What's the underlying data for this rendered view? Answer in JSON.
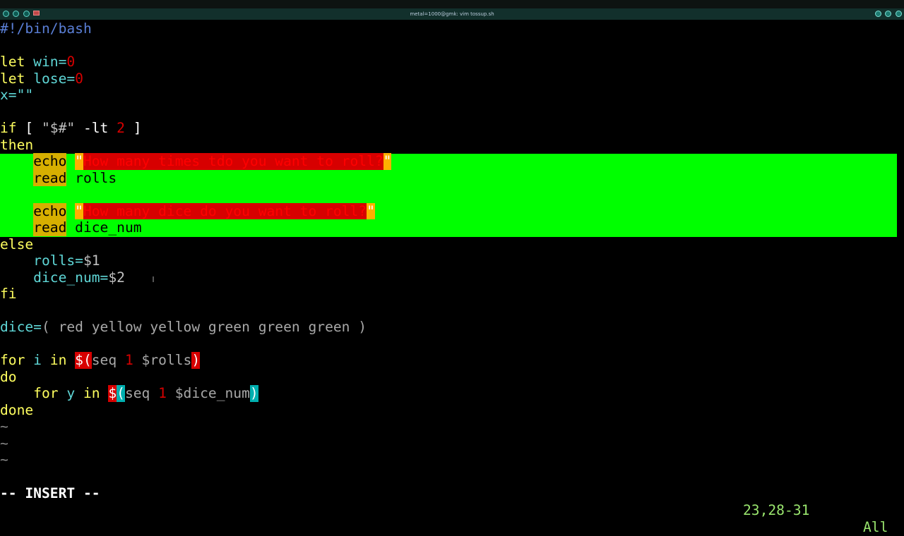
{
  "window": {
    "title": "metal=1000@gmk: vim tossup.sh"
  },
  "editor": {
    "lines": [
      {
        "segments": [
          {
            "t": "#!/bin/bash",
            "c": "#5a7fd6"
          }
        ]
      },
      {
        "segments": []
      },
      {
        "segments": [
          {
            "t": "let",
            "c": "#ffff5f"
          },
          {
            "t": " win=",
            "c": "#5fd7d7"
          },
          {
            "t": "0",
            "c": "#d70000"
          }
        ]
      },
      {
        "segments": [
          {
            "t": "let",
            "c": "#ffff5f"
          },
          {
            "t": " lose=",
            "c": "#5fd7d7"
          },
          {
            "t": "0",
            "c": "#d70000"
          }
        ]
      },
      {
        "segments": [
          {
            "t": "x=\"\"",
            "c": "#5fd7d7"
          }
        ]
      },
      {
        "segments": []
      },
      {
        "segments": [
          {
            "t": "if",
            "c": "#ffff5f"
          },
          {
            "t": " [ ",
            "c": "#ffffff"
          },
          {
            "t": "\"$#\"",
            "c": "#c0c0c0"
          },
          {
            "t": " -lt ",
            "c": "#ffffff"
          },
          {
            "t": "2",
            "c": "#d70000"
          },
          {
            "t": " ]",
            "c": "#ffffff"
          }
        ]
      },
      {
        "segments": [
          {
            "t": "then",
            "c": "#ffff5f"
          }
        ]
      },
      {
        "segments": [
          {
            "t": "    ",
            "c": "#000"
          },
          {
            "t": "echo",
            "c": "#000000",
            "bg": "#d7af00"
          },
          {
            "t": " ",
            "c": "#000"
          },
          {
            "t": "\"",
            "c": "#ffffff",
            "bg": "#ffaf00"
          },
          {
            "t": "How many times tdo you want to roll?",
            "c": "#ff0000",
            "bg": "#d70000"
          },
          {
            "t": "\"",
            "c": "#ffffff",
            "bg": "#ffaf00"
          }
        ]
      },
      {
        "segments": [
          {
            "t": "    ",
            "c": "#000"
          },
          {
            "t": "read",
            "c": "#000000",
            "bg": "#d7af00"
          },
          {
            "t": " rolls",
            "c": "#000000"
          }
        ]
      },
      {
        "segments": []
      },
      {
        "segments": [
          {
            "t": "    ",
            "c": "#000"
          },
          {
            "t": "echo",
            "c": "#000000",
            "bg": "#d7af00"
          },
          {
            "t": " ",
            "c": "#000"
          },
          {
            "t": "\"",
            "c": "#ffffff",
            "bg": "#ffaf00"
          },
          {
            "t": "How many dice do you want to roll?",
            "c": "#ff0000",
            "bg": "#d70000"
          },
          {
            "t": "\"",
            "c": "#ffffff",
            "bg": "#ffaf00"
          }
        ]
      },
      {
        "segments": [
          {
            "t": "    ",
            "c": "#000"
          },
          {
            "t": "read",
            "c": "#000000",
            "bg": "#d7af00"
          },
          {
            "t": " dice_num",
            "c": "#000000"
          }
        ]
      },
      {
        "segments": [
          {
            "t": "else",
            "c": "#ffff5f"
          }
        ]
      },
      {
        "segments": [
          {
            "t": "    rolls=",
            "c": "#5fd7d7"
          },
          {
            "t": "$1",
            "c": "#c0c0c0"
          }
        ]
      },
      {
        "segments": [
          {
            "t": "    dice_num=",
            "c": "#5fd7d7"
          },
          {
            "t": "$2",
            "c": "#c0c0c0"
          }
        ]
      },
      {
        "segments": [
          {
            "t": "fi",
            "c": "#ffff5f"
          }
        ]
      },
      {
        "segments": []
      },
      {
        "segments": [
          {
            "t": "dice=",
            "c": "#5fd7d7"
          },
          {
            "t": "( red yellow yellow green green green )",
            "c": "#a8a8a8"
          }
        ]
      },
      {
        "segments": []
      },
      {
        "segments": [
          {
            "t": "for",
            "c": "#ffff5f"
          },
          {
            "t": " i ",
            "c": "#5fd7d7"
          },
          {
            "t": "in",
            "c": "#ffff5f"
          },
          {
            "t": " ",
            "c": "#fff"
          },
          {
            "t": "$(",
            "c": "#ffffff",
            "bg": "#d70000"
          },
          {
            "t": "seq ",
            "c": "#a8a8a8"
          },
          {
            "t": "1",
            "c": "#d70000"
          },
          {
            "t": " $rolls",
            "c": "#a8a8a8"
          },
          {
            "t": ")",
            "c": "#ffffff",
            "bg": "#d70000"
          }
        ]
      },
      {
        "segments": [
          {
            "t": "do",
            "c": "#ffff5f"
          }
        ]
      },
      {
        "segments": [
          {
            "t": "    for",
            "c": "#ffff5f"
          },
          {
            "t": " y ",
            "c": "#5fd7d7"
          },
          {
            "t": "in",
            "c": "#ffff5f"
          },
          {
            "t": " ",
            "c": "#fff"
          },
          {
            "t": "$",
            "c": "#ffffff",
            "bg": "#d70000"
          },
          {
            "t": "(",
            "c": "#ffffff",
            "bg": "#00afaf"
          },
          {
            "t": "seq ",
            "c": "#a8a8a8"
          },
          {
            "t": "1",
            "c": "#d70000"
          },
          {
            "t": " $dice_num",
            "c": "#a8a8a8"
          },
          {
            "t": ")",
            "c": "#ffffff",
            "bg": "#00afaf"
          }
        ]
      },
      {
        "segments": [
          {
            "t": "done",
            "c": "#ffff5f"
          }
        ]
      },
      {
        "segments": [
          {
            "t": "~",
            "c": "#888888"
          }
        ]
      },
      {
        "segments": [
          {
            "t": "~",
            "c": "#888888"
          }
        ]
      },
      {
        "segments": [
          {
            "t": "~",
            "c": "#888888"
          }
        ]
      }
    ]
  },
  "statusline": {
    "mode": "-- INSERT --",
    "ruler": "23,28-31",
    "position": "All"
  }
}
